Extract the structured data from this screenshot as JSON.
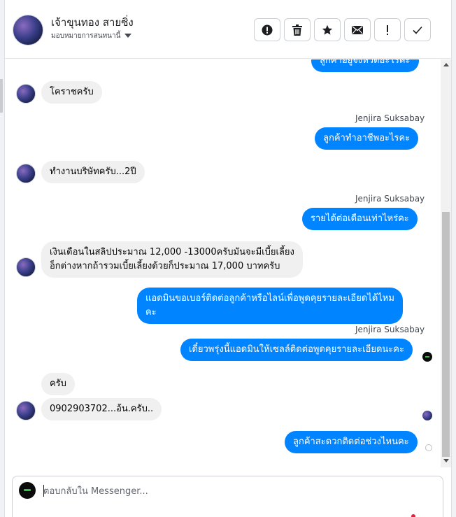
{
  "header": {
    "contact_name": "เจ้าขุนทอง สายซิ่ง",
    "assign_label": "มอบหมายการสนทนานี้",
    "tools": [
      {
        "name": "mark-spam-button",
        "glyph": "!",
        "icon": "alert-circle-icon"
      },
      {
        "name": "delete-button",
        "glyph": "🗑",
        "icon": "trash-icon"
      },
      {
        "name": "star-button",
        "glyph": "★",
        "icon": "star-icon"
      },
      {
        "name": "mark-unread-button",
        "glyph": "✉",
        "icon": "envelope-icon"
      },
      {
        "name": "follow-up-button",
        "glyph": "!",
        "icon": "exclamation-icon"
      },
      {
        "name": "mark-done-button",
        "glyph": "✓",
        "icon": "check-icon"
      }
    ]
  },
  "messages": {
    "top_partial": "ลูกค้าอยู่จังหวัดอะไรคะ",
    "m1": "โคราชครับ",
    "sender1": "Jenjira Suksabay",
    "m2": "ลูกค้าทำอาชีพอะไรคะ",
    "m3": "ทำงานบริษัทครับ...2ปี",
    "sender2": "Jenjira Suksabay",
    "m4": "รายได้ต่อเดือนเท่าไหร่คะ",
    "m5_line1": "เงินเดือนในสลิปประมาณ 12,000 -13000ครับมันจะมีเบี้ยเลี้ยง",
    "m5_line2": "อ็กต่างหากถ้ารวมเบี้ยเลี้ยงด้วยก็ประมาณ 17,000 บาทครับ",
    "m6_line1": "แอดมินขอเบอร์ติดต่อลูกค้าหรือไลน์เพื่อพูดคุยรายละเอียดได้ไหม",
    "m6_line2": "คะ",
    "sender3": "Jenjira Suksabay",
    "m7": "เดี๋ยวพรุ่งนี้แอดมินให้เซลล์ติดต่อพูดคุยรายละเอียดนะคะ",
    "m8": "ครับ",
    "m9": "0902903702...อ้น.ครับ..",
    "m10": "ลูกค้าสะดวกติดต่อช่วงไหนคะ"
  },
  "composer": {
    "placeholder": "ตอบกลับใน Messenger..."
  },
  "colors": {
    "outgoing_bubble": "#0084ff",
    "incoming_bubble": "#f0f0f0"
  }
}
